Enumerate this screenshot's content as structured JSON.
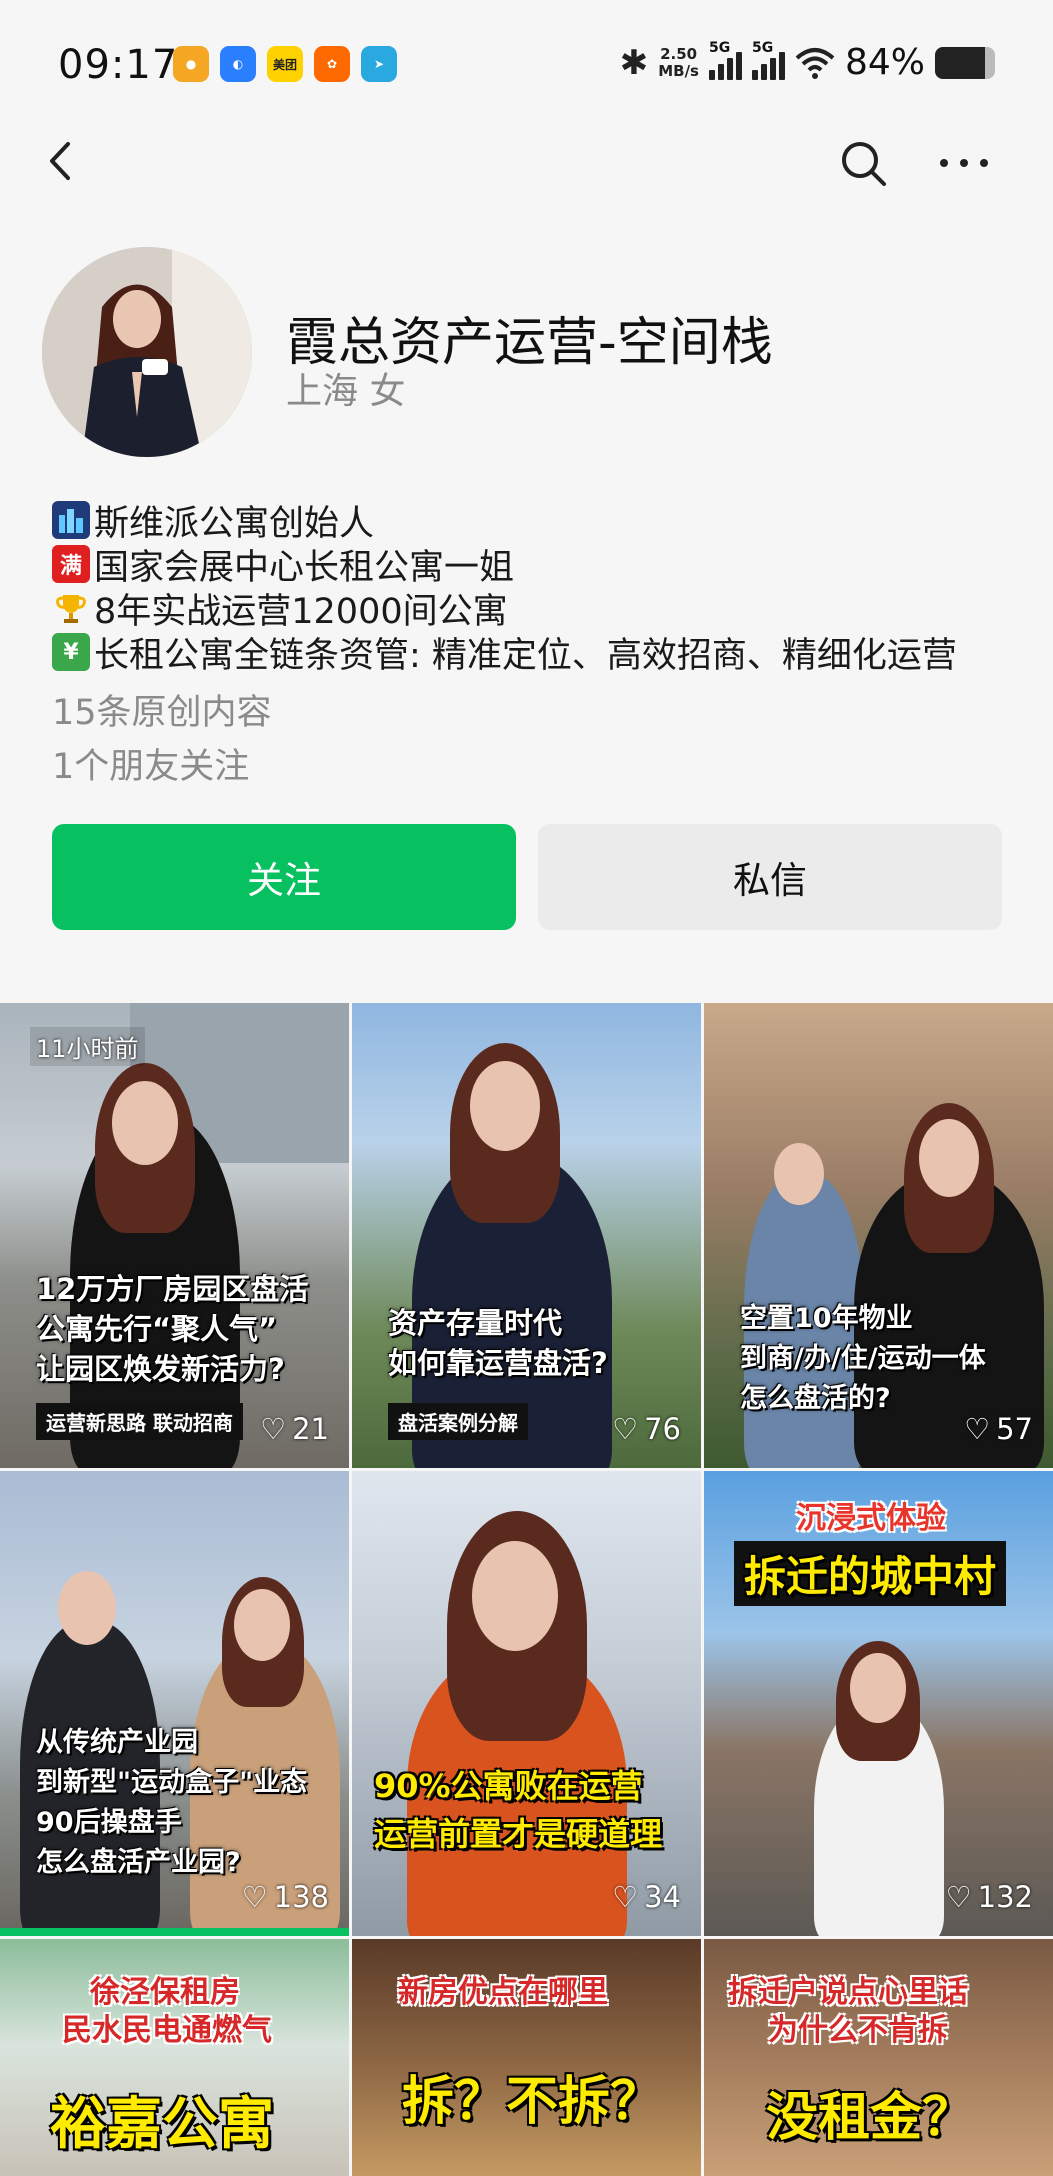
{
  "status_bar": {
    "time": "09:17",
    "app_icons": [
      {
        "name": "weibo-icon",
        "label": "",
        "color": "#f5a623"
      },
      {
        "name": "chat-bubble-icon",
        "label": "",
        "color": "#2a7fff"
      },
      {
        "name": "meituan-icon",
        "label": "美团",
        "color": "#ffd100"
      },
      {
        "name": "taobao-icon",
        "label": "",
        "color": "#ff6a00"
      },
      {
        "name": "paper-plane-icon",
        "label": "",
        "color": "#2aa8e0"
      }
    ],
    "speed_value": "2.50",
    "speed_unit": "MB/s",
    "network_1": "5G",
    "network_2": "5G",
    "battery_percent": "84%",
    "battery_level": 0.84
  },
  "nav": {
    "back_icon": "chevron-left-icon",
    "search_icon": "search-icon",
    "more_icon": "more-dots-icon"
  },
  "profile": {
    "name": "霞总资产运营-空间栈",
    "location_gender": "上海 女",
    "bio": [
      {
        "icon": "cityscape-emoji-icon",
        "text": "斯维派公寓创始人"
      },
      {
        "icon": "full-badge-emoji-icon",
        "icon_text": "满",
        "text": "国家会展中心长租公寓一姐"
      },
      {
        "icon": "trophy-emoji-icon",
        "icon_text": "🏆",
        "text": "8年实战运营12000间公寓"
      },
      {
        "icon": "yen-chart-emoji-icon",
        "icon_text": "¥",
        "text": "长租公寓全链条资管: 精准定位、高效招商、精细化运营"
      }
    ],
    "original_count": "15条原创内容",
    "friends_following": "1个朋友关注"
  },
  "actions": {
    "follow_label": "关注",
    "message_label": "私信",
    "accent": "#07c160"
  },
  "videos": [
    {
      "time_badge": "11小时前",
      "caption": [
        "12万方厂房园区盘活",
        "公寓先行“聚人气”",
        "让园区焕发新活力?"
      ],
      "tag": "运营新思路 联动招商",
      "likes": "21"
    },
    {
      "caption": [
        "资产存量时代",
        "如何靠运营盘活?"
      ],
      "tag": "盘活案例分解",
      "likes": "76"
    },
    {
      "caption": [
        "空置10年物业",
        "到商/办/住/运动一体",
        "怎么盘活的?"
      ],
      "likes": "57"
    },
    {
      "caption": [
        "从传统产业园",
        "到新型\"运动盒子\"业态",
        "90后操盘手",
        "怎么盘活产业园?"
      ],
      "likes": "138",
      "progress": 1.0
    },
    {
      "banner": [
        "90%公寓败在运营",
        "运营前置才是硬道理"
      ],
      "likes": "34"
    },
    {
      "top_title": "沉浸式体验",
      "banner": [
        "拆迁的城中村"
      ],
      "likes": "132"
    },
    {
      "top_title": [
        "徐泾保租房",
        "民水民电通燃气"
      ],
      "banner": [
        "裕嘉公寓"
      ]
    },
    {
      "top_title": [
        "新房优点在哪里"
      ],
      "banner": [
        "拆？不拆？"
      ]
    },
    {
      "top_title": [
        "拆迁户说点心里话",
        "为什么不肯拆"
      ],
      "banner": [
        "没租金？"
      ]
    }
  ]
}
